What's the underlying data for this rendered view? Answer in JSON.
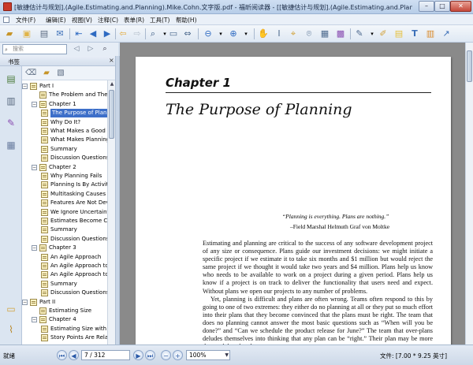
{
  "window": {
    "title": "[敏捷估计与规划].(Agile.Estimating.and.Planning).Mike.Cohn.文字版.pdf - 福昕阅读器 - [[敏捷估计与规划].(Agile.Estimating.and.Planning).Mike...",
    "min_symbol": "–",
    "max_symbol": "□",
    "close_symbol": "✕"
  },
  "menu": [
    "文件(F)",
    "编辑(E)",
    "视图(V)",
    "注释(C)",
    "表单(R)",
    "工具(T)",
    "帮助(H)"
  ],
  "search": {
    "placeholder": "搜索"
  },
  "sidebar": {
    "header": "书签",
    "close_symbol": "×",
    "bookmarks": [
      {
        "label": "Part I",
        "level": 0,
        "expanded": true
      },
      {
        "label": "The Problem and The Goal",
        "level": 1
      },
      {
        "label": "Chapter 1",
        "level": 1,
        "expanded": true
      },
      {
        "label": "The Purpose of Planning",
        "level": 2,
        "selected": true
      },
      {
        "label": "Why Do It?",
        "level": 2
      },
      {
        "label": "What Makes a Good Plan?",
        "level": 2
      },
      {
        "label": "What Makes Planning Agile?",
        "level": 2
      },
      {
        "label": "Summary",
        "level": 2
      },
      {
        "label": "Discussion Questions",
        "level": 2
      },
      {
        "label": "Chapter 2",
        "level": 1,
        "expanded": true
      },
      {
        "label": "Why Planning Fails",
        "level": 2
      },
      {
        "label": "Planning Is By Activity Rather Than Feature",
        "level": 2
      },
      {
        "label": "Multitasking Causes Further Delays",
        "level": 2
      },
      {
        "label": "Features Are Not Developed By Priority",
        "level": 2
      },
      {
        "label": "We Ignore Uncertainty",
        "level": 2
      },
      {
        "label": "Estimates Become Commitments",
        "level": 2
      },
      {
        "label": "Summary",
        "level": 2
      },
      {
        "label": "Discussion Questions",
        "level": 2
      },
      {
        "label": "Chapter 3",
        "level": 1,
        "expanded": true
      },
      {
        "label": "An Agile Approach",
        "level": 2
      },
      {
        "label": "An Agile Approach to Projects",
        "level": 2
      },
      {
        "label": "An Agile Approach to Planning",
        "level": 2
      },
      {
        "label": "Summary",
        "level": 2
      },
      {
        "label": "Discussion Questions",
        "level": 2
      },
      {
        "label": "Part II",
        "level": 0,
        "expanded": true
      },
      {
        "label": "Estimating Size",
        "level": 1
      },
      {
        "label": "Chapter 4",
        "level": 1,
        "expanded": true
      },
      {
        "label": "Estimating Size with Story Points",
        "level": 2
      },
      {
        "label": "Story Points Are Relative",
        "level": 2
      }
    ]
  },
  "document": {
    "chapter_label": "Chapter 1",
    "chapter_title": "The Purpose of Planning",
    "epigraph_quote": "“Planning is everything. Plans are nothing.”",
    "epigraph_author": "–Field Marshal Helmuth Graf von Moltke",
    "paragraphs": [
      "Estimating and planning are critical to the success of any software development project of any size or consequence. Plans guide our investment decisions: we might initiate a specific project if we estimate it to take six months and $1 million but would reject the same project if we thought it would take two years and $4 million. Plans help us know who needs to be available to work on a project during a given period. Plans help us know if a project is on track to deliver the functionality that users need and expect. Without plans we open our projects to any number of problems.",
      "Yet, planning is difficult and plans are often wrong. Teams often respond to this by going to one of two extremes: they either do no planning at all or they put so much effort into their plans that they become convinced that the plans must be right. The team that does no planning cannot answer the most basic questions such as “When will you be done?” and “Can we schedule the product release for June?” The team that over-plans deludes themselves into thinking that any plan can be “right.” Their plan may be more thorough but that does not nec-"
    ]
  },
  "status": {
    "ready": "就绪",
    "page": "7 / 312",
    "zoom": "100%",
    "page_size": "文件: [7.00 * 9.25 英寸]"
  }
}
